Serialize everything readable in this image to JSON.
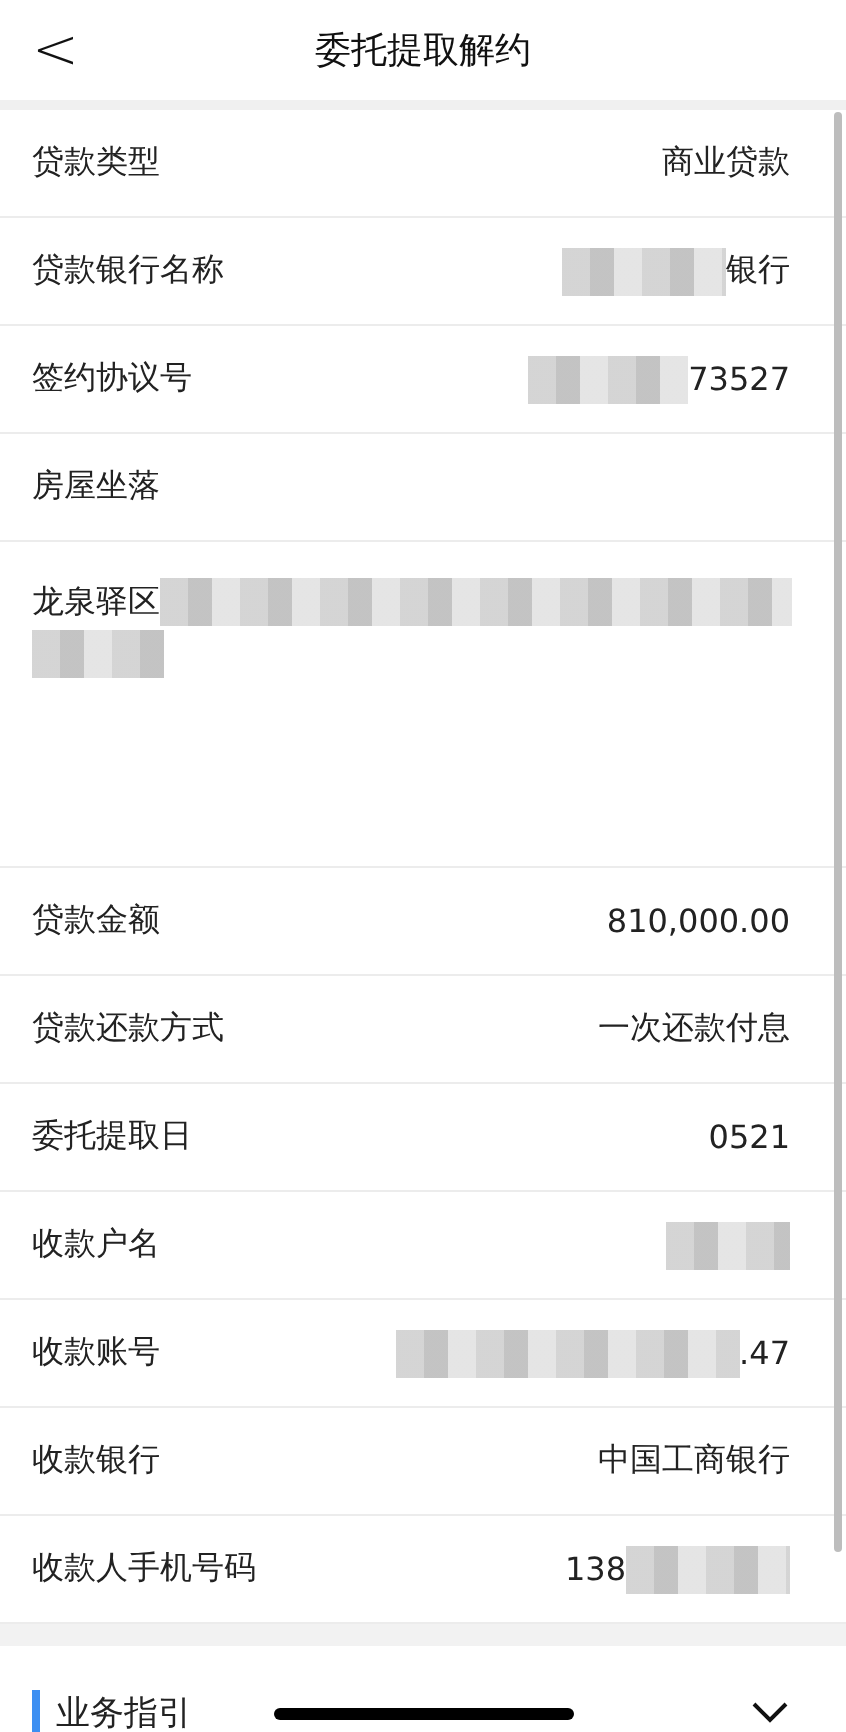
{
  "header": {
    "back": "<",
    "title": "委托提取解约"
  },
  "rows": [
    {
      "kind": "field",
      "label": "贷款类型",
      "value": "商业贷款"
    },
    {
      "kind": "field",
      "label": "贷款银行名称",
      "value": "银行",
      "mask_before": true
    },
    {
      "kind": "field",
      "label": "签约协议号",
      "value": "73527",
      "mask_before": true
    },
    {
      "kind": "heading",
      "label": "房屋坐落"
    },
    {
      "kind": "address",
      "value": "龙泉驿区",
      "mask_after": true
    },
    {
      "kind": "field",
      "label": "贷款金额",
      "value": "810,000.00"
    },
    {
      "kind": "field",
      "label": "贷款还款方式",
      "value": "一次还款付息"
    },
    {
      "kind": "field",
      "label": "委托提取日",
      "value": "0521"
    },
    {
      "kind": "field",
      "label": "收款户名",
      "mask_before": true
    },
    {
      "kind": "field",
      "label": "收款账号",
      "value": ".47",
      "mask_before": true
    },
    {
      "kind": "field",
      "label": "收款银行",
      "value": "中国工商银行"
    },
    {
      "kind": "field",
      "label": "收款人手机号码",
      "value": "138",
      "mask_after": true
    }
  ],
  "section": {
    "title": "业务指引",
    "expanded": false
  }
}
